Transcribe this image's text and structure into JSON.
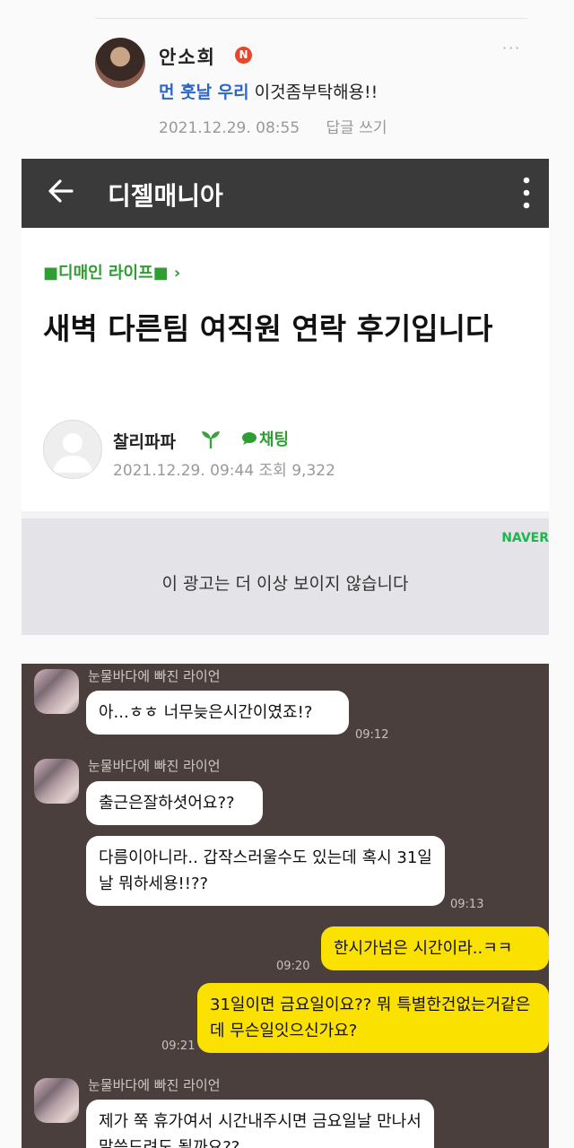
{
  "comment": {
    "author": "안소희",
    "badge": "N",
    "more": "···",
    "mention": "먼 훗날 우리",
    "text": " 이것좀부탁해용!!",
    "timestamp": "2021.12.29. 08:55",
    "reply": "답글 쓰기"
  },
  "appbar": {
    "title": "디젤매니아"
  },
  "article": {
    "category": "■디매인 라이프■ ›",
    "title": "새벽 다른팀 여직원 연락 후기입니다",
    "author": "찰리파파",
    "chat_label": "채팅",
    "meta": "2021.12.29. 09:44  조회 9,322"
  },
  "ad": {
    "brand": "NAVER",
    "text": "이 광고는 더 이상 보이지 않습니다"
  },
  "chat": {
    "sender": "눈물바다에 빠진 라이언",
    "messages": [
      {
        "text": "아...ㅎㅎ 너무늦은시간이였죠!?",
        "time": "09:12"
      },
      {
        "text": "출근은잘하셧어요??"
      },
      {
        "text": "다름이아니라.. 갑작스러울수도 있는데 혹시 31일날 뭐하세용!!??",
        "time": "09:13"
      },
      {
        "text": "한시가넘은 시간이라..ㅋㅋ",
        "time": "09:20"
      },
      {
        "text": "31일이면 금요일이요?? 뭐 특별한건없는거같은데 무슨일잇으신가요?",
        "time": "09:21"
      },
      {
        "text": "제가 쭉 휴가여서 시간내주시면 금요일날 만나서 말씀드려도 될까요??"
      }
    ]
  },
  "colors": {
    "appbar_bg": "#3a3a3a",
    "accent_green": "#2e9e33",
    "chat_bg": "#4a3f3c",
    "bubble_yellow": "#fae100",
    "mention_blue": "#2d66c9"
  }
}
